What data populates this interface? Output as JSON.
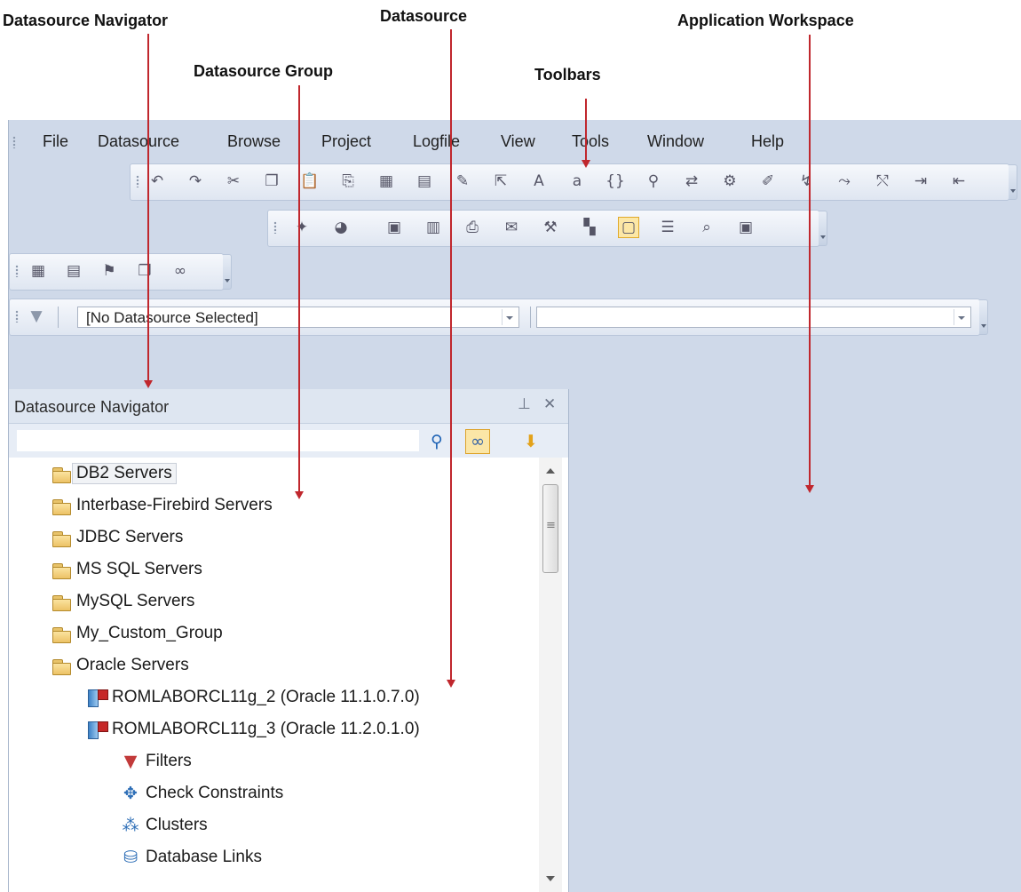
{
  "annotations": {
    "datasource_navigator": "Datasource Navigator",
    "datasource": "Datasource",
    "application_workspace": "Application Workspace",
    "datasource_group": "Datasource Group",
    "toolbars": "Toolbars"
  },
  "menu": [
    "File",
    "Datasource",
    "Browse",
    "Project",
    "Logfile",
    "View",
    "Tools",
    "Window",
    "Help"
  ],
  "toolbar_icons": {
    "main": [
      "undo-icon",
      "redo-icon",
      "cut-icon",
      "copy-icon",
      "paste-icon",
      "paste-special-icon",
      "sql-icon",
      "script-icon",
      "edit-icon",
      "export-icon",
      "font-size-up-icon",
      "font-size-down-icon",
      "braces-icon",
      "find-icon",
      "find-replace-icon",
      "tools-icon",
      "pencil-icon",
      "format-icon",
      "format-sql-icon",
      "unformat-icon",
      "indent-icon",
      "outdent-icon"
    ],
    "file": [
      "new-icon",
      "open-icon",
      "save-icon",
      "save-all-icon",
      "print-icon",
      "mail-icon",
      "settings-icon",
      "layout-icon",
      "window-icon",
      "list-icon",
      "preview-icon",
      "panel-icon"
    ],
    "view": [
      "grid-icon",
      "detail-icon",
      "hierarchy-icon",
      "copy-window-icon",
      "binoculars-icon"
    ]
  },
  "datasource_bar": {
    "selected": "[No Datasource Selected]",
    "secondary": ""
  },
  "navigator": {
    "title": "Datasource Navigator",
    "search_placeholder": "",
    "tree": [
      {
        "label": "DB2 Servers",
        "icon": "folder-icon",
        "level": 0
      },
      {
        "label": "Interbase-Firebird Servers",
        "icon": "folder-icon",
        "level": 0
      },
      {
        "label": "JDBC Servers",
        "icon": "folder-icon",
        "level": 0
      },
      {
        "label": "MS SQL Servers",
        "icon": "folder-icon",
        "level": 0
      },
      {
        "label": "MySQL Servers",
        "icon": "folder-icon",
        "level": 0
      },
      {
        "label": "My_Custom_Group",
        "icon": "folder-icon",
        "level": 0
      },
      {
        "label": "Oracle Servers",
        "icon": "folder-icon",
        "level": 0
      },
      {
        "label": "ROMLABORCL11g_2 (Oracle 11.1.0.7.0)",
        "icon": "database-server-icon",
        "level": 1
      },
      {
        "label": "ROMLABORCL11g_3 (Oracle 11.2.0.1.0)",
        "icon": "database-server-icon",
        "level": 1
      },
      {
        "label": "Filters",
        "icon": "filter-icon",
        "level": 2
      },
      {
        "label": "Check Constraints",
        "icon": "check-constraints-icon",
        "level": 2
      },
      {
        "label": "Clusters",
        "icon": "clusters-icon",
        "level": 2
      },
      {
        "label": "Database Links",
        "icon": "database-links-icon",
        "level": 2
      }
    ]
  }
}
